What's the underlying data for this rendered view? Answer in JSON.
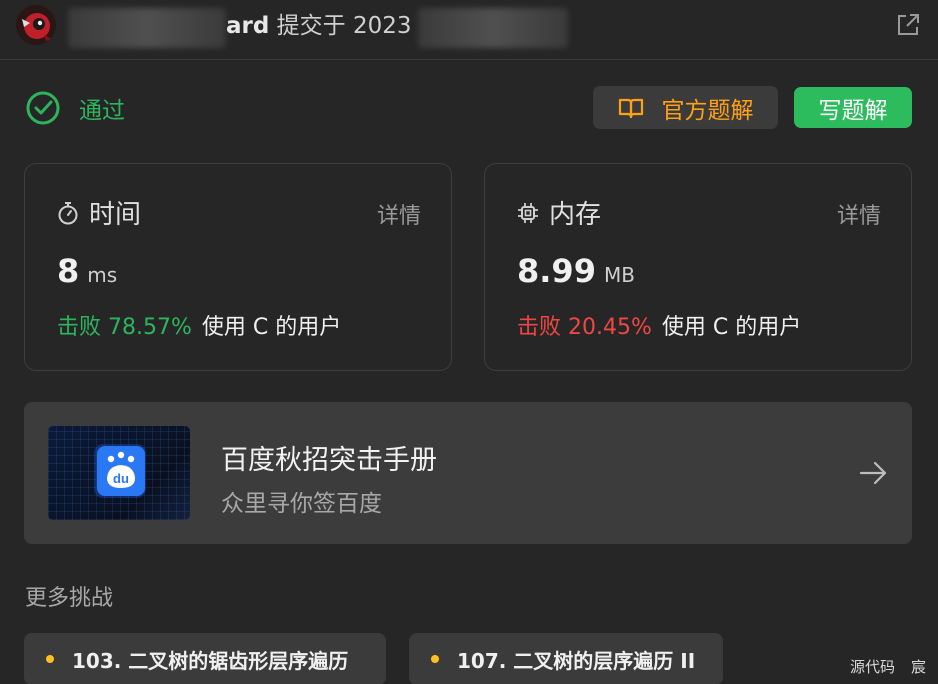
{
  "header": {
    "username_suffix": "ard",
    "submitted_text": "提交于 2023",
    "external_link_icon": "external-link-icon"
  },
  "status": {
    "label": "通过",
    "color": "#2db55d"
  },
  "actions": {
    "official_solution_label": "官方题解",
    "write_solution_label": "写题解"
  },
  "time_card": {
    "title": "时间",
    "detail_label": "详情",
    "value": "8",
    "unit": "ms",
    "beat_label": "击败 78.57%",
    "beat_suffix": "使用 C 的用户"
  },
  "memory_card": {
    "title": "内存",
    "detail_label": "详情",
    "value": "8.99",
    "unit": "MB",
    "beat_label": "击败 20.45%",
    "beat_suffix": "使用 C 的用户"
  },
  "ad": {
    "logo_text": "du",
    "title": "百度秋招突击手册",
    "subtitle": "众里寻你签百度"
  },
  "more": {
    "title": "更多挑战",
    "items": [
      {
        "label": "103. 二叉树的锯齿形层序遍历"
      },
      {
        "label": "107. 二叉树的层序遍历 II"
      }
    ]
  },
  "footer": {
    "source_label": "源代码",
    "extra_label": "宸"
  },
  "colors": {
    "accent_green": "#2cbb5d",
    "accent_orange": "#ffa116",
    "accent_red": "#ef4743",
    "background": "#262626"
  }
}
